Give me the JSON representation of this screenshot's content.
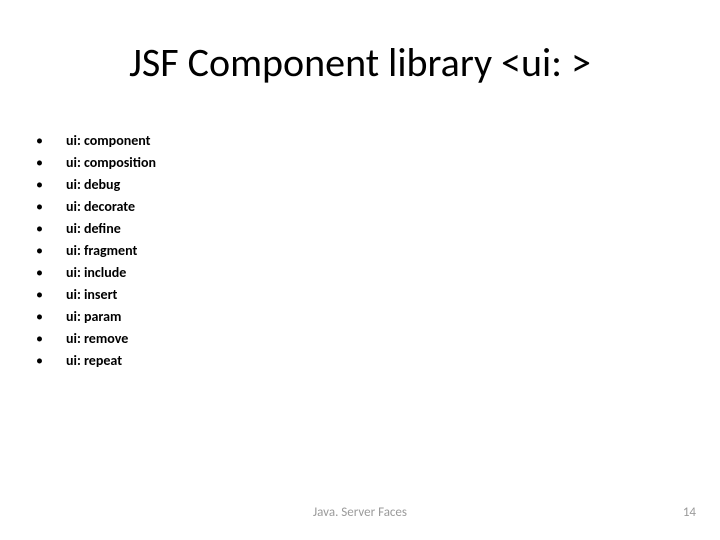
{
  "title": "JSF Component library <ui: >",
  "items": [
    "ui: component",
    "ui: composition",
    "ui: debug",
    "ui: decorate",
    "ui: define",
    "ui: fragment",
    "ui: include",
    "ui: insert",
    "ui: param",
    "ui: remove",
    "ui: repeat"
  ],
  "footer_center": "Java. Server Faces",
  "footer_right": "14"
}
